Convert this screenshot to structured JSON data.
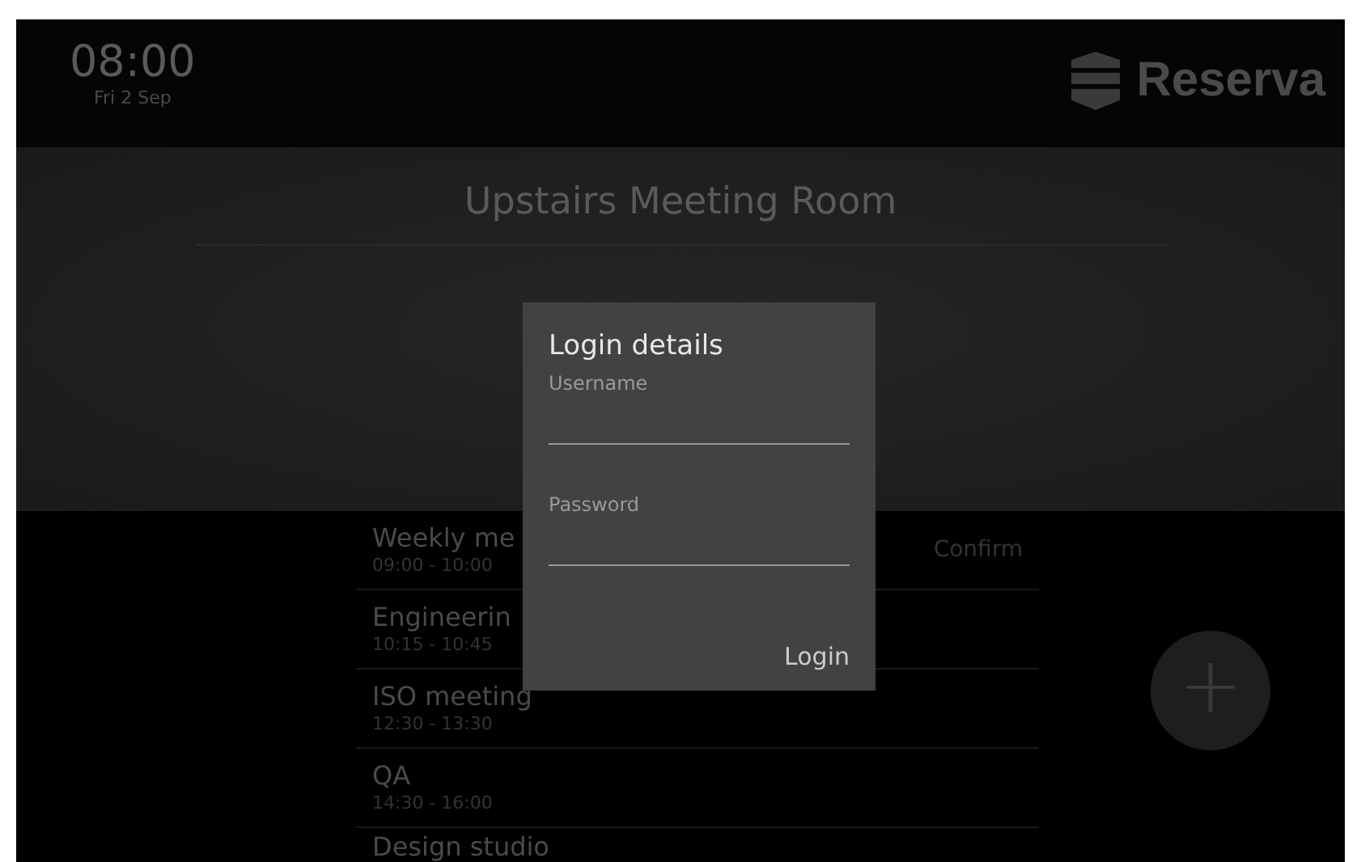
{
  "clock": {
    "time": "08:00",
    "date": "Fri 2 Sep"
  },
  "brand": {
    "name": "Reserva"
  },
  "room": {
    "title": "Upstairs Meeting Room"
  },
  "meetings": [
    {
      "title": "Weekly me",
      "time": "09:00 - 10:00",
      "action": "Confirm"
    },
    {
      "title": "Engineerin",
      "time": "10:15 - 10:45"
    },
    {
      "title": "ISO meeting",
      "time": "12:30 - 13:30"
    },
    {
      "title": "QA",
      "time": "14:30 - 16:00"
    },
    {
      "title": "Design studio"
    }
  ],
  "add_button": {
    "label": "+"
  },
  "dialog": {
    "title": "Login details",
    "fields": [
      {
        "label": "Username"
      },
      {
        "label": "Password"
      }
    ],
    "submit": "Login"
  }
}
